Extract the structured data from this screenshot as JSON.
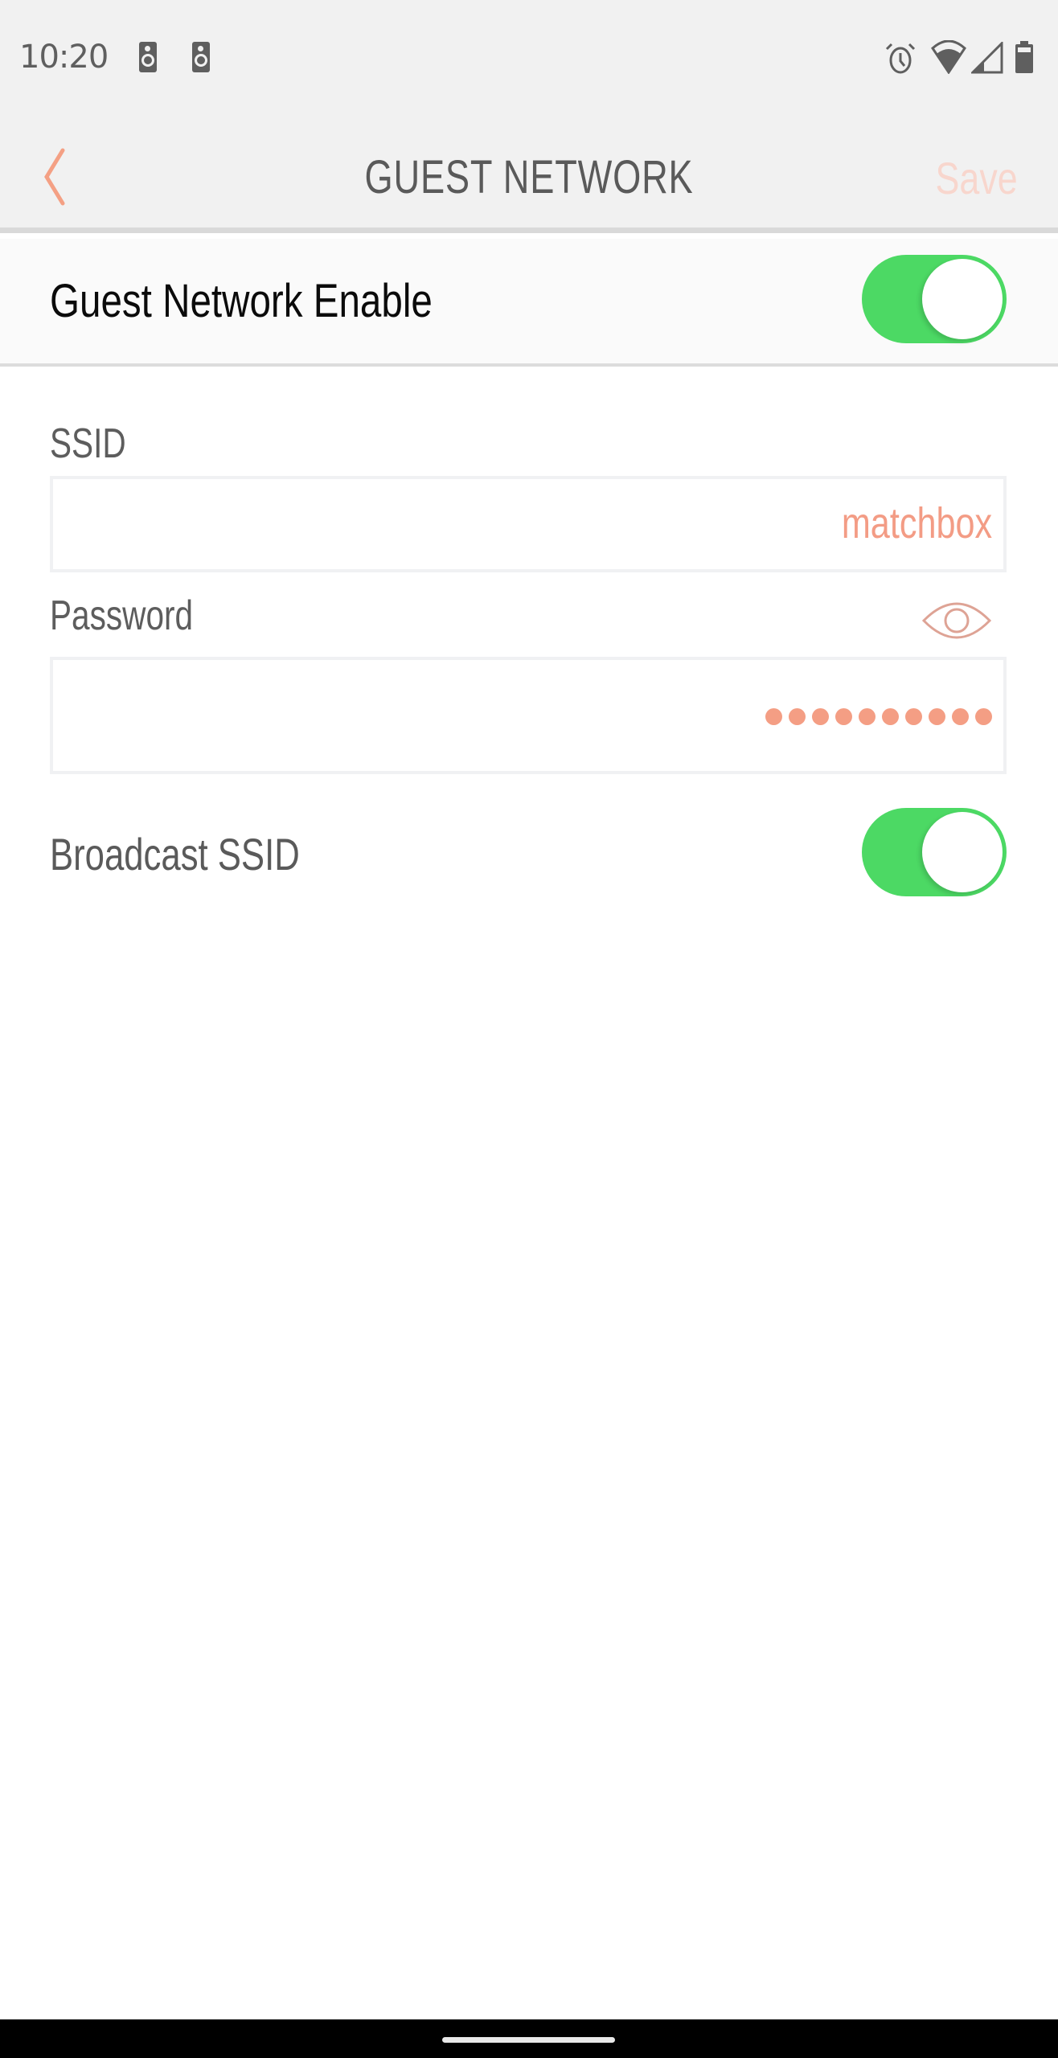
{
  "status_bar": {
    "time": "10:20",
    "left_icons": [
      "speaker-icon",
      "speaker-icon"
    ],
    "right_icons": [
      "alarm-icon",
      "wifi-icon",
      "cell-signal-icon",
      "battery-icon"
    ]
  },
  "header": {
    "back_icon": "chevron-left-icon",
    "title": "GUEST NETWORK",
    "save_label": "Save"
  },
  "guest_network": {
    "label": "Guest Network Enable",
    "enabled": true
  },
  "form": {
    "ssid_label": "SSID",
    "ssid_value": "matchbox",
    "password_label": "Password",
    "password_masked": "••••••••••",
    "password_length": 10,
    "show_password_icon": "eye-icon",
    "broadcast_label": "Broadcast SSID",
    "broadcast_enabled": true
  },
  "colors": {
    "accent": "#f39c85",
    "save_disabled": "#f8d6cd",
    "toggle_on": "#4cd964",
    "title_text": "#5a5a5a",
    "header_bg": "#f1f1f1"
  }
}
